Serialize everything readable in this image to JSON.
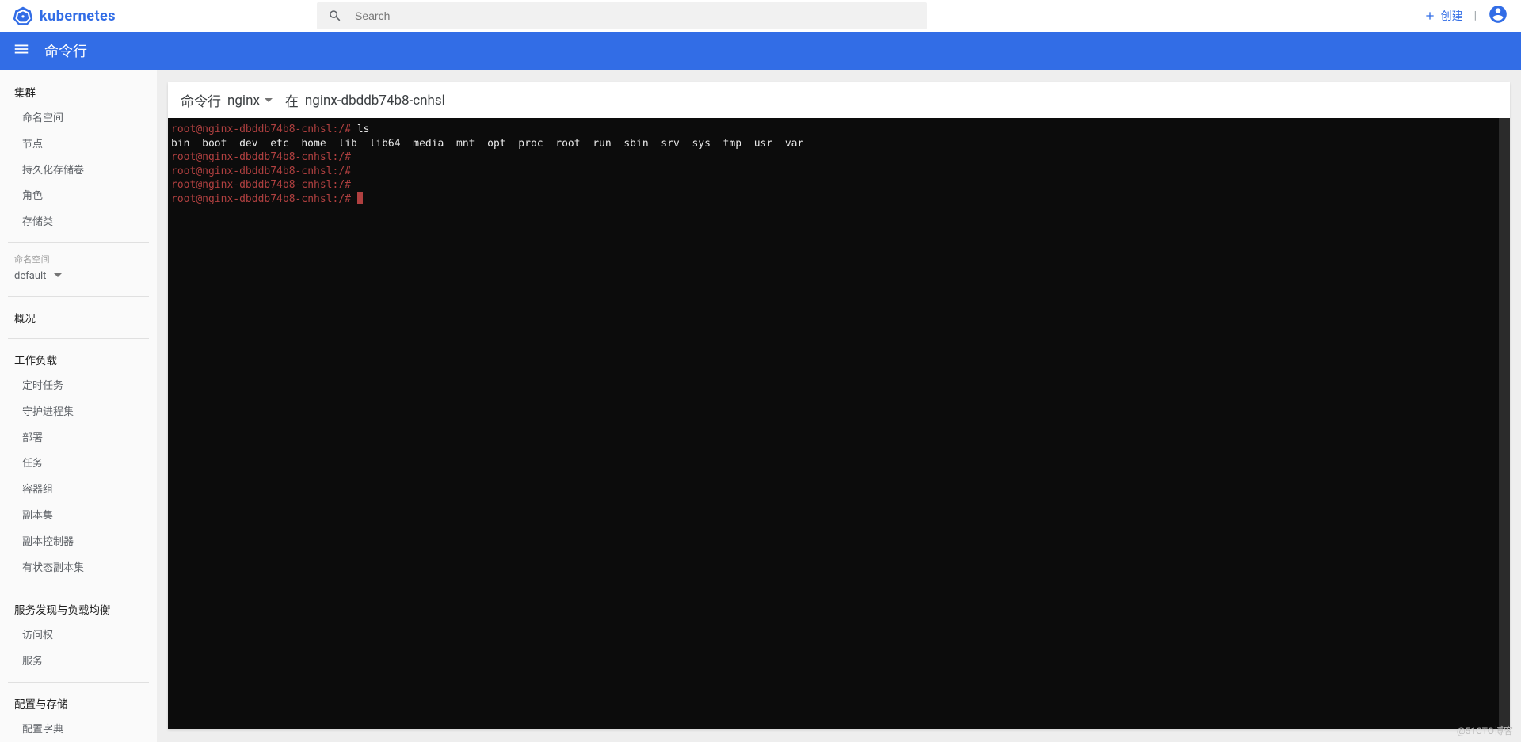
{
  "header": {
    "brand": "kubernetes",
    "search_placeholder": "Search",
    "create_label": "创建",
    "separator": "|"
  },
  "toolbar": {
    "title": "命令行"
  },
  "sidebar": {
    "cluster_heading": "集群",
    "cluster_items": [
      "命名空间",
      "节点",
      "持久化存储卷",
      "角色",
      "存储类"
    ],
    "namespace_label": "命名空间",
    "namespace_selected": "default",
    "overview_heading": "概况",
    "workloads_heading": "工作负载",
    "workloads_items": [
      "定时任务",
      "守护进程集",
      "部署",
      "任务",
      "容器组",
      "副本集",
      "副本控制器",
      "有状态副本集"
    ],
    "discovery_heading": "服务发现与负载均衡",
    "discovery_items": [
      "访问权",
      "服务"
    ],
    "config_heading": "配置与存储",
    "config_items": [
      "配置字典"
    ]
  },
  "shell": {
    "title_prefix": "命令行",
    "pod_name": "nginx",
    "in_prefix": "在",
    "pod_full": "nginx-dbddb74b8-cnhsl",
    "prompt_user": "root",
    "prompt_host": "nginx-dbddb74b8-cnhsl",
    "prompt_path": "/",
    "lines": [
      {
        "cmd": "ls"
      },
      {
        "out": "bin  boot  dev  etc  home  lib  lib64  media  mnt  opt  proc  root  run  sbin  srv  sys  tmp  usr  var"
      },
      {
        "cmd": ""
      },
      {
        "cmd": ""
      },
      {
        "cmd": ""
      },
      {
        "cmd": ""
      }
    ]
  },
  "watermark": "@51CTO博客"
}
